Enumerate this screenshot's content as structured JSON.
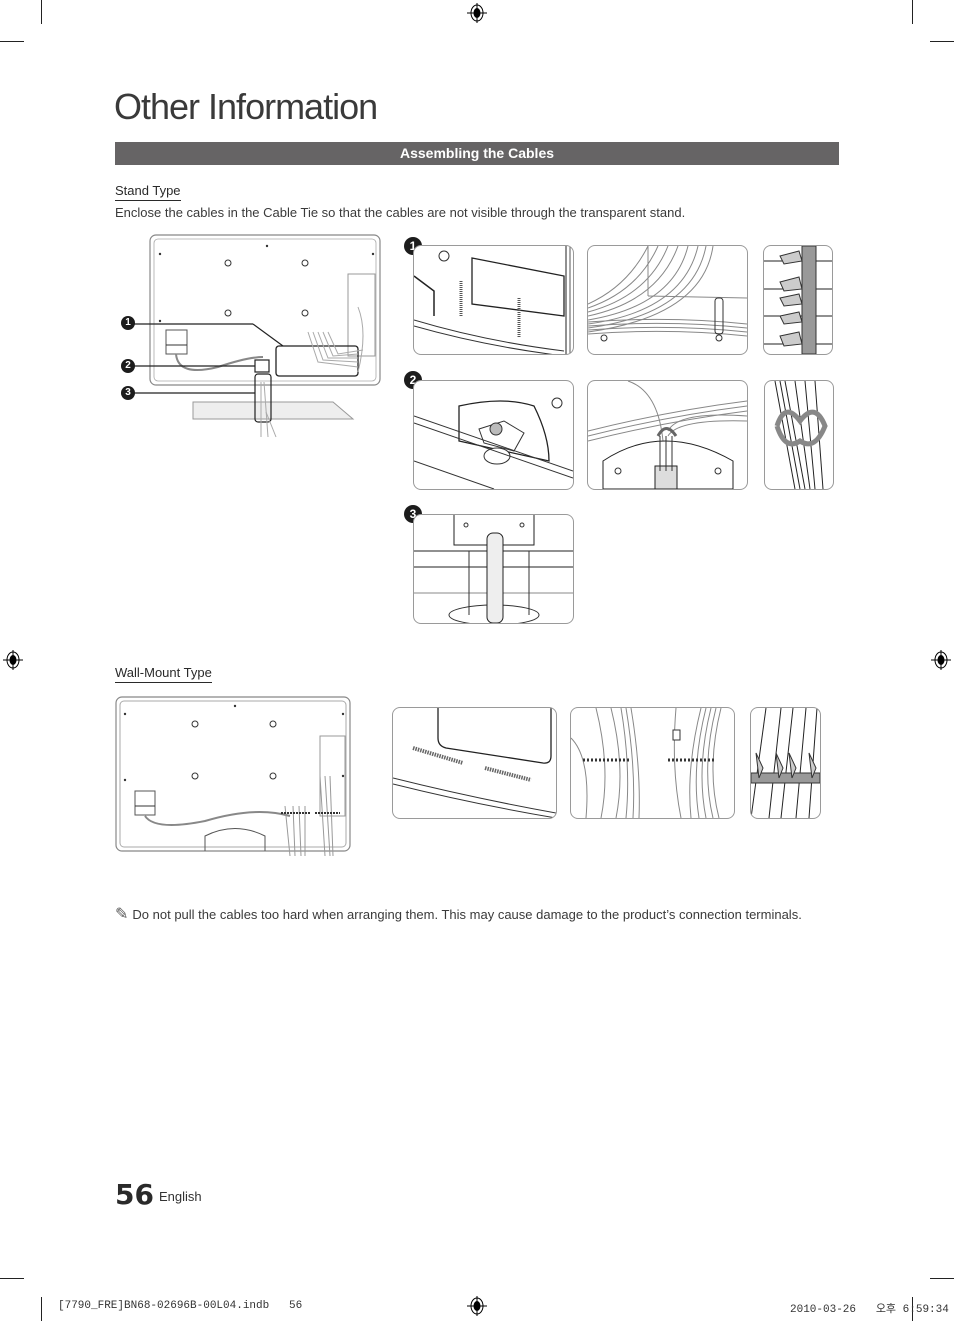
{
  "page": {
    "section_title": "Other Information",
    "section_bar": "Assembling the Cables",
    "stand_type": {
      "heading": "Stand Type",
      "description": "Enclose the cables in the Cable Tie so that the cables are not visible through the transparent stand.",
      "callouts": [
        "1",
        "2",
        "3"
      ]
    },
    "wall_mount_type": {
      "heading": "Wall-Mount Type"
    },
    "note": {
      "icon": "pencil-note-icon",
      "text": "Do not pull the cables too hard when arranging them. This may cause damage to the product’s connection terminals."
    },
    "footer": {
      "page_number": "56",
      "language": "English"
    },
    "print_slug": {
      "file": "[7790_FRE]BN68-02696B-00L04.indb   56",
      "timestamp": "2010-03-26   오후 6:59:34"
    }
  }
}
